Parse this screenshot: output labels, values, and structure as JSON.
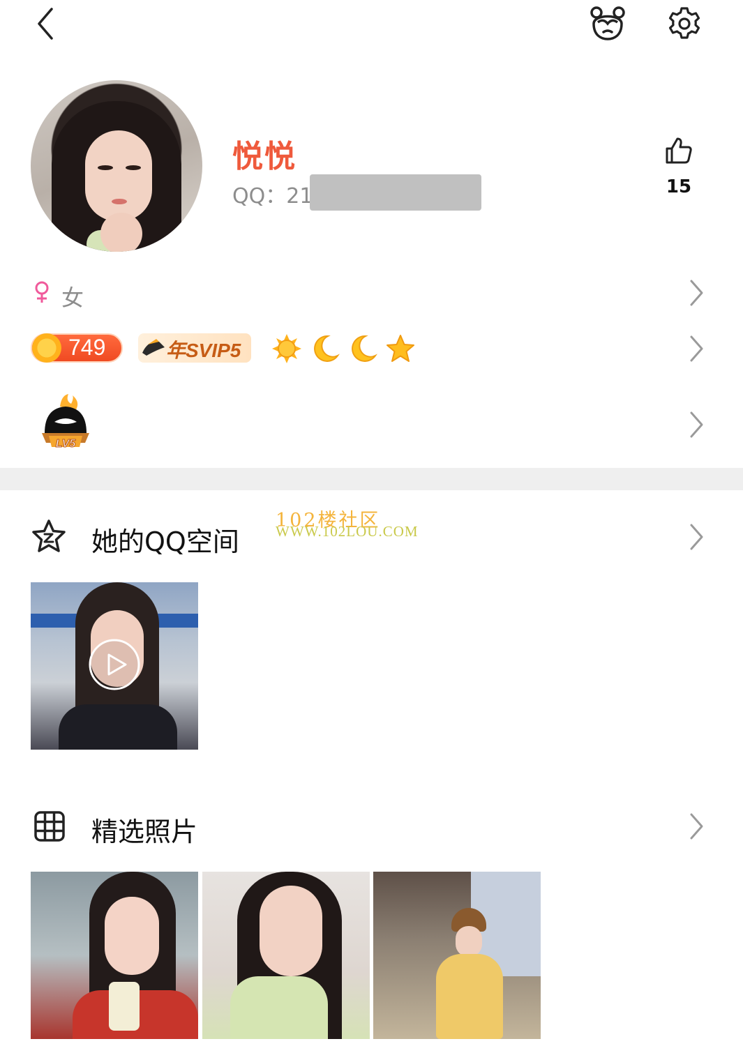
{
  "topbar": {
    "back_icon": "chevron-left-icon",
    "pet_icon": "panda-face-icon",
    "settings_icon": "gear-icon"
  },
  "profile": {
    "nickname": "悦悦",
    "qq_label": "QQ：21",
    "like_count": "15",
    "like_icon": "thumbs-up-icon"
  },
  "info": {
    "gender_icon": "female-symbol-icon",
    "gender_text": "女",
    "points": "749",
    "svip": "年SVIP5",
    "level_icons": [
      "sun-icon",
      "moon-icon",
      "moon-icon",
      "star-icon"
    ],
    "badge_label": "LV5"
  },
  "qzone": {
    "title": "她的QQ空间",
    "icon": "qzone-star-icon"
  },
  "watermark": {
    "line1": "102楼社区",
    "line2": "WWW.102LOU.COM"
  },
  "photos": {
    "title": "精选照片",
    "icon": "grid-icon"
  },
  "colors": {
    "accent": "#ef5a3c",
    "chevron": "#9a9a9a",
    "female": "#f05a9b",
    "divider": "#efefef"
  }
}
